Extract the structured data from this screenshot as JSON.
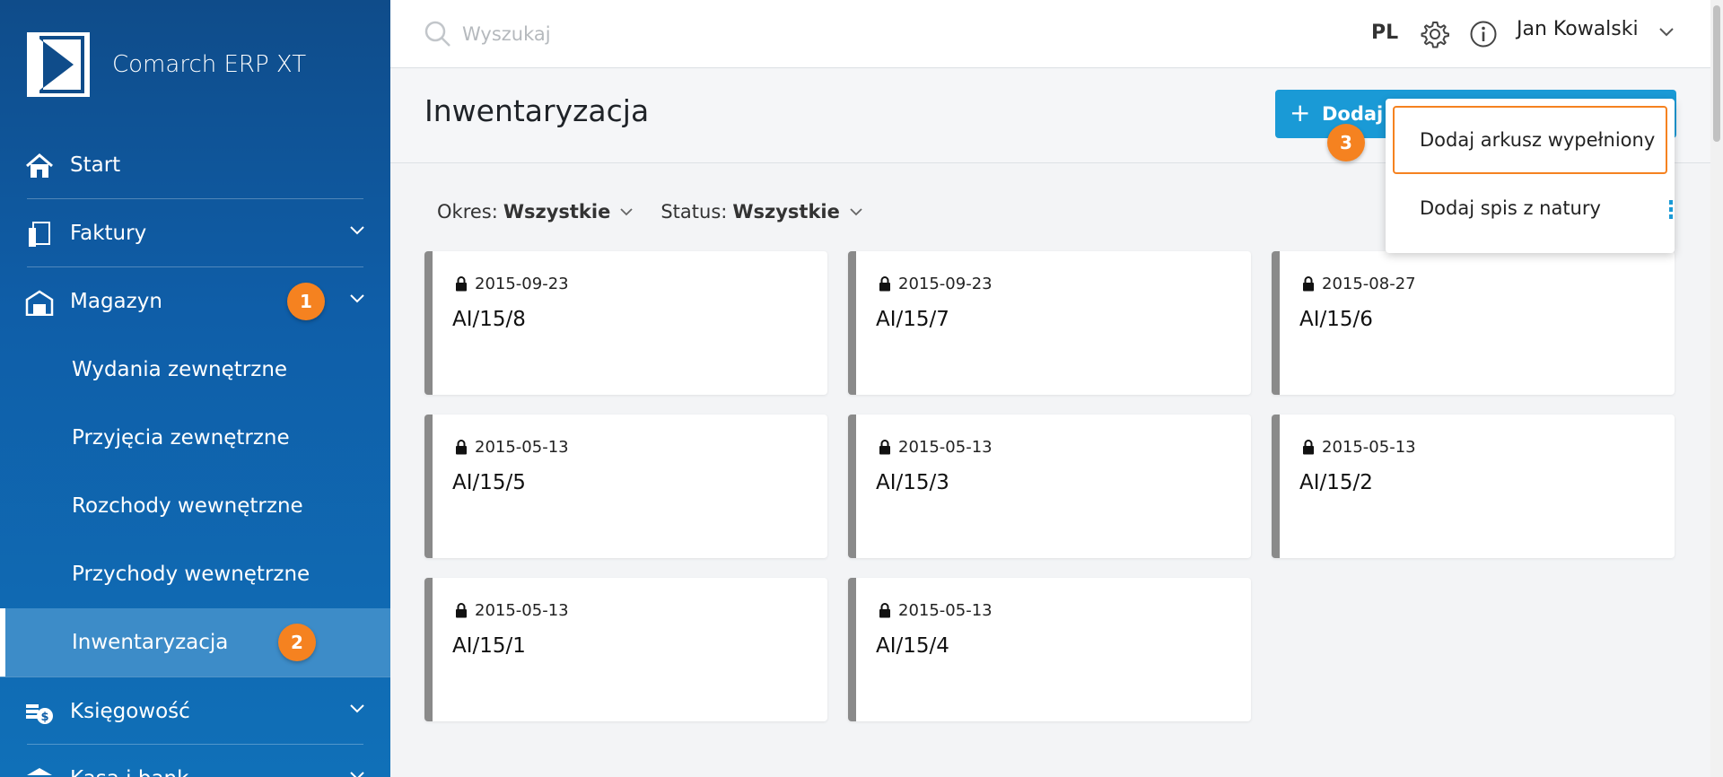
{
  "app": {
    "logo_text": "Comarch ERP XT"
  },
  "sidebar": {
    "items": [
      {
        "label": "Start",
        "icon": "home-icon"
      },
      {
        "label": "Faktury",
        "icon": "invoices-icon"
      },
      {
        "label": "Magazyn",
        "icon": "warehouse-icon"
      }
    ],
    "sub_items": [
      {
        "label": "Wydania zewnętrzne"
      },
      {
        "label": "Przyjęcia zewnętrzne"
      },
      {
        "label": "Rozchody wewnętrzne"
      },
      {
        "label": "Przychody wewnętrzne"
      },
      {
        "label": "Inwentaryzacja"
      }
    ],
    "bottom_items": [
      {
        "label": "Księgowość",
        "icon": "accounting-icon"
      },
      {
        "label": "Kasa i bank",
        "icon": "bank-icon"
      }
    ],
    "badges": {
      "b1": "1",
      "b2": "2"
    },
    "colors": {
      "active_bg": "#3d8cc8",
      "badge": "#f58220"
    }
  },
  "topbar": {
    "search_placeholder": "Wyszukaj",
    "language": "PL",
    "user_name": "Jan Kowalski"
  },
  "page": {
    "title": "Inwentaryzacja",
    "add_button_label": "Dodaj a",
    "badge3": "3",
    "filters": [
      {
        "label": "Okres:",
        "value": "Wszystkie"
      },
      {
        "label": "Status:",
        "value": "Wszystkie"
      }
    ]
  },
  "dropdown": {
    "items": [
      {
        "label": "Dodaj arkusz wypełniony"
      },
      {
        "label": "Dodaj spis z natury"
      }
    ]
  },
  "cards": [
    {
      "date": "2015-09-23",
      "number": "AI/15/8"
    },
    {
      "date": "2015-09-23",
      "number": "AI/15/7"
    },
    {
      "date": "2015-08-27",
      "number": "AI/15/6"
    },
    {
      "date": "2015-05-13",
      "number": "AI/15/5"
    },
    {
      "date": "2015-05-13",
      "number": "AI/15/3"
    },
    {
      "date": "2015-05-13",
      "number": "AI/15/2"
    },
    {
      "date": "2015-05-13",
      "number": "AI/15/1"
    },
    {
      "date": "2015-05-13",
      "number": "AI/15/4"
    }
  ]
}
